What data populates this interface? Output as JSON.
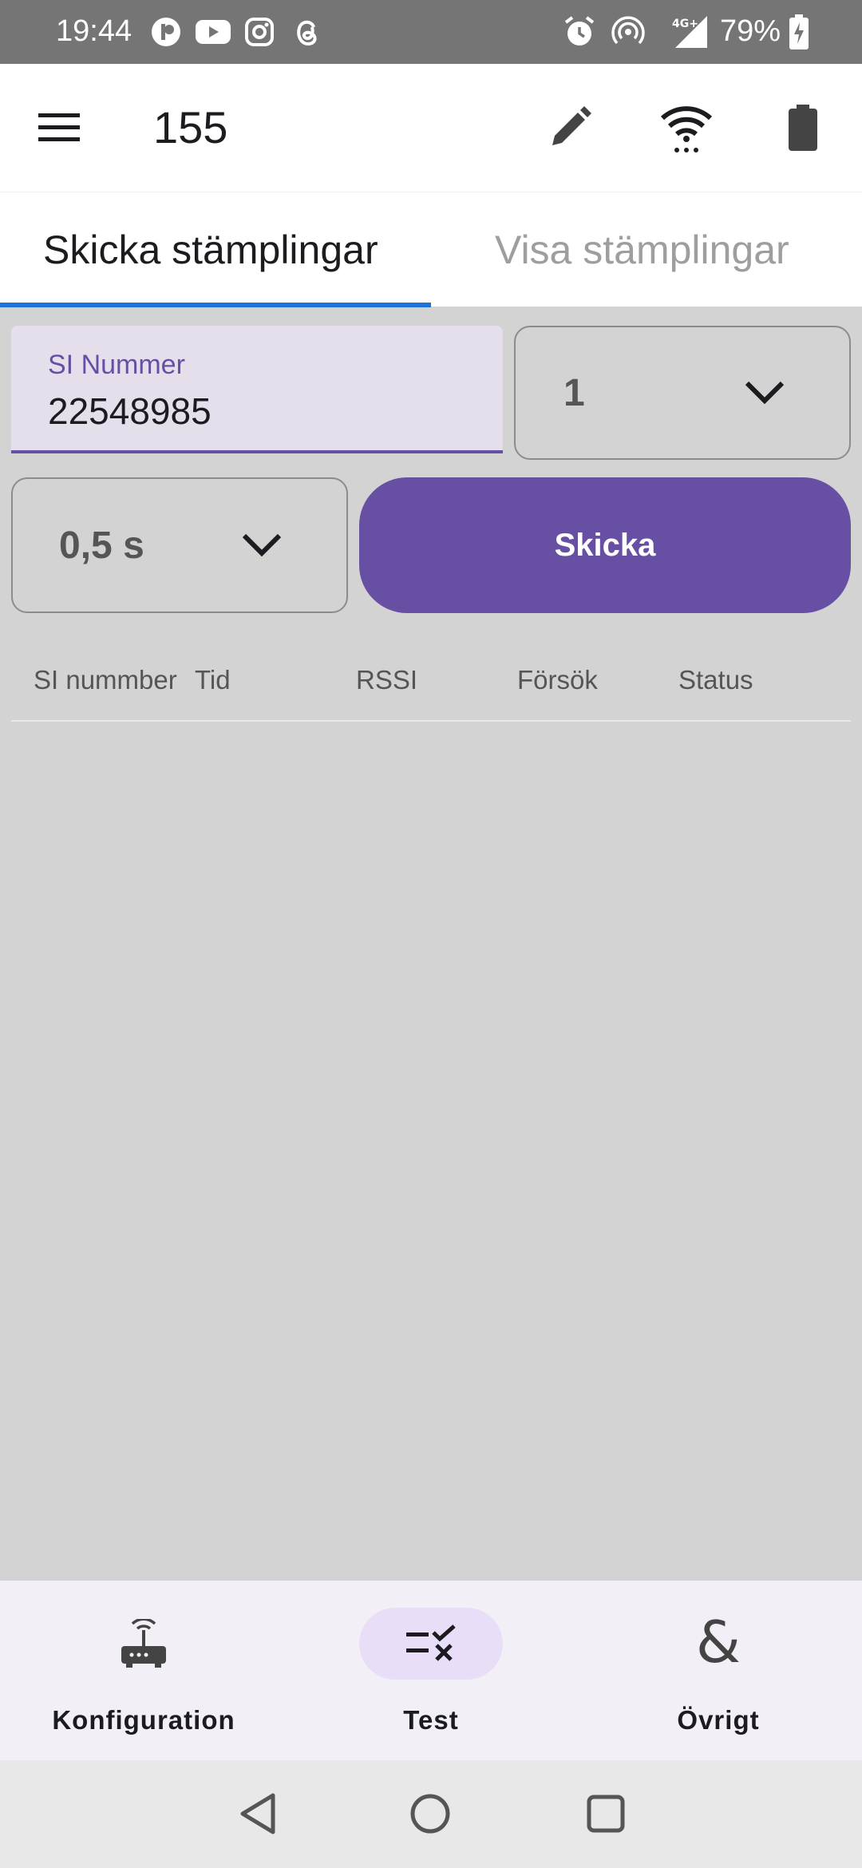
{
  "status_bar": {
    "time": "19:44",
    "network": "4G+",
    "battery_text": "79%",
    "icons": [
      "threads-like-app-icon",
      "youtube-icon",
      "instagram-icon",
      "threads-icon",
      "alarm-icon",
      "hotspot-icon",
      "signal-icon",
      "battery-charging-icon"
    ]
  },
  "app_bar": {
    "title": "155",
    "icons": [
      "menu-icon",
      "edit-pencil-icon",
      "wifi-icon",
      "battery-icon"
    ]
  },
  "tabs": [
    {
      "label": "Skicka stämplingar",
      "active": true
    },
    {
      "label": "Visa stämplingar",
      "active": false
    }
  ],
  "si_field": {
    "label": "SI Nummer",
    "value": "22548985"
  },
  "count_select": {
    "value": "1"
  },
  "interval_select": {
    "value": "0,5 s"
  },
  "send_button": {
    "label": "Skicka"
  },
  "table": {
    "columns": [
      "SI nummber",
      "Tid",
      "RSSI",
      "Försök",
      "Status"
    ],
    "rows": []
  },
  "bottom_nav": [
    {
      "label": "Konfiguration",
      "icon": "router-icon",
      "active": false
    },
    {
      "label": "Test",
      "icon": "checklist-icon",
      "active": true
    },
    {
      "label": "Övrigt",
      "icon": "ampersand-icon",
      "active": false
    }
  ],
  "colors": {
    "primary": "#674fa3",
    "tab_indicator": "#1e73d8",
    "field_bg": "#e5dfec",
    "content_bg": "#d3d3d3",
    "nav_bg": "#f3eff6",
    "nav_active_pill": "#e8def8"
  }
}
